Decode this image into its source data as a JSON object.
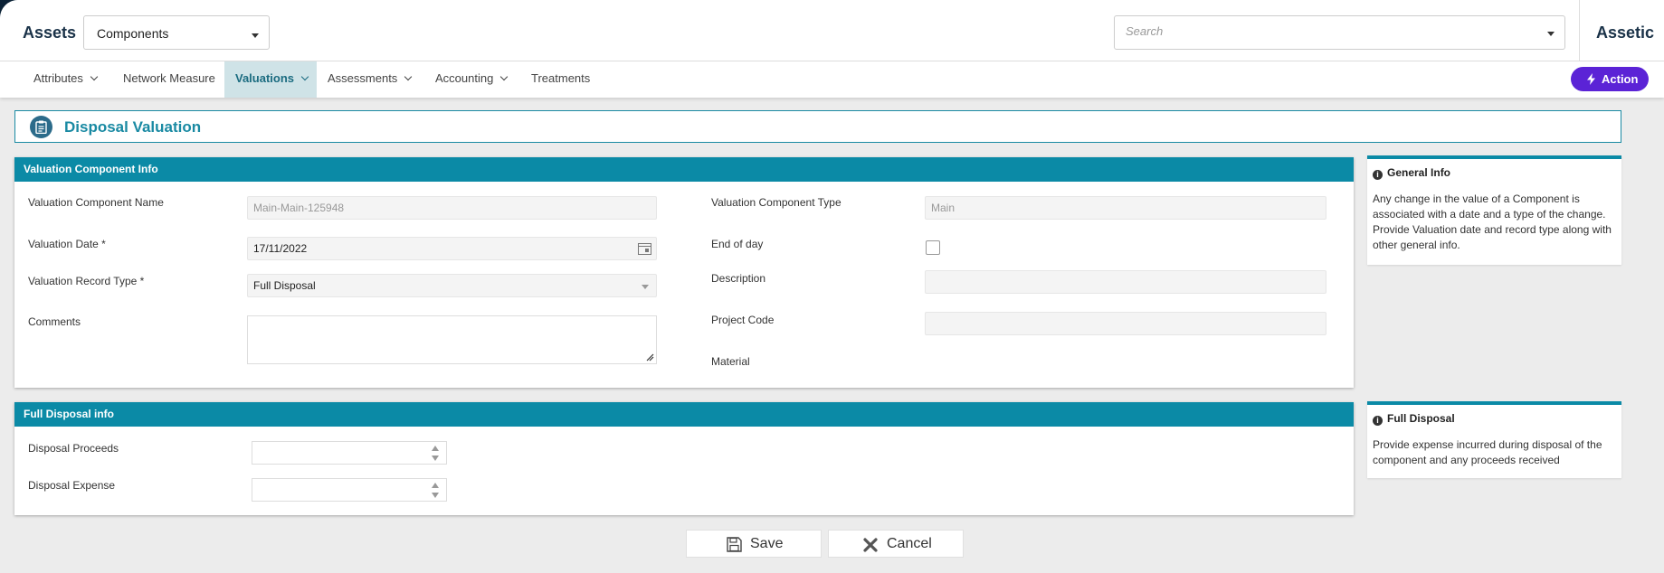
{
  "header": {
    "app_title": "Assets",
    "module_select": "Components",
    "search_placeholder": "Search",
    "brand": "Assetic"
  },
  "nav": {
    "items": [
      {
        "label": "Attributes",
        "has_menu": true
      },
      {
        "label": "Network Measure",
        "has_menu": false
      },
      {
        "label": "Valuations",
        "has_menu": true,
        "active": true
      },
      {
        "label": "Assessments",
        "has_menu": true
      },
      {
        "label": "Accounting",
        "has_menu": true
      },
      {
        "label": "Treatments",
        "has_menu": false
      }
    ],
    "action_label": "Action"
  },
  "page": {
    "title": "Disposal Valuation"
  },
  "component_info": {
    "heading": "Valuation Component Info",
    "name_label": "Valuation Component Name",
    "name_value": "Main-Main-125948",
    "type_label": "Valuation Component Type",
    "type_value": "Main",
    "date_label": "Valuation Date *",
    "date_value": "17/11/2022",
    "end_of_day_label": "End of day",
    "end_of_day_checked": false,
    "record_type_label": "Valuation Record Type *",
    "record_type_value": "Full Disposal",
    "description_label": "Description",
    "description_value": "",
    "comments_label": "Comments",
    "comments_value": "",
    "project_code_label": "Project Code",
    "project_code_value": "",
    "material_label": "Material"
  },
  "disposal_info": {
    "heading": "Full Disposal info",
    "proceeds_label": "Disposal Proceeds",
    "proceeds_value": "",
    "expense_label": "Disposal Expense",
    "expense_value": ""
  },
  "side_info": {
    "general": {
      "heading": "General Info",
      "lines": [
        "Any change in the value of a Component is",
        "associated with a date and a type of the change.",
        "Provide Valuation date and record type along with",
        "other general info."
      ]
    },
    "disposal": {
      "heading": "Full Disposal",
      "lines": [
        "Provide expense incurred during disposal of the",
        "component and any proceeds received"
      ]
    }
  },
  "buttons": {
    "save": "Save",
    "cancel": "Cancel"
  },
  "colors": {
    "accent": "#0b8aa6",
    "action": "#5b23d6",
    "brand_text": "#1a3248"
  },
  "icons": {
    "title": "clipboard-icon",
    "save": "floppy-disk-icon",
    "cancel": "x-mark-icon",
    "action": "lightning-bolt-icon",
    "info": "info-circle-icon"
  }
}
